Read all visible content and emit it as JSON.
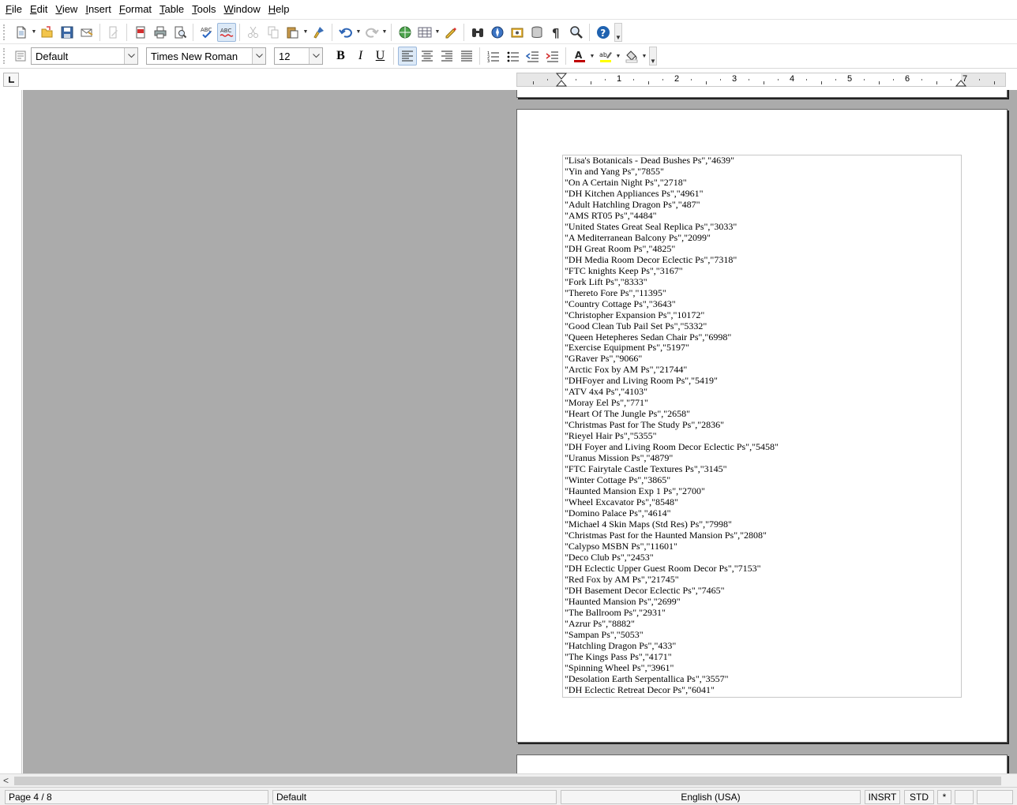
{
  "menu": [
    {
      "label": "File",
      "u": "F",
      "rest": "ile"
    },
    {
      "label": "Edit",
      "u": "E",
      "rest": "dit"
    },
    {
      "label": "View",
      "u": "V",
      "rest": "iew"
    },
    {
      "label": "Insert",
      "u": "I",
      "rest": "nsert"
    },
    {
      "label": "Format",
      "u": "F",
      "rest": "ormat"
    },
    {
      "label": "Table",
      "u": "T",
      "rest": "able"
    },
    {
      "label": "Tools",
      "u": "T",
      "rest": "ools"
    },
    {
      "label": "Window",
      "u": "W",
      "rest": "indow"
    },
    {
      "label": "Help",
      "u": "H",
      "rest": "elp"
    }
  ],
  "formatting": {
    "paragraph_style": "Default",
    "font_name": "Times New Roman",
    "font_size": "12",
    "bold": "B",
    "italic": "I",
    "underline": "U"
  },
  "ruler": {
    "labels": [
      "1",
      "2",
      "3",
      "4",
      "5",
      "6",
      "7"
    ]
  },
  "document": {
    "lines": [
      "\"Lisa's Botanicals - Dead Bushes Ps\",\"4639\"",
      "\"Yin and Yang Ps\",\"7855\"",
      "\"On A Certain Night Ps\",\"2718\"",
      "\"DH Kitchen Appliances Ps\",\"4961\"",
      "\"Adult Hatchling Dragon Ps\",\"487\"",
      "\"AMS RT05 Ps\",\"4484\"",
      "\"United States Great Seal Replica Ps\",\"3033\"",
      "\"A Mediterranean Balcony Ps\",\"2099\"",
      "\"DH Great Room Ps\",\"4825\"",
      "\"DH Media Room Decor Eclectic Ps\",\"7318\"",
      "\"FTC knights Keep Ps\",\"3167\"",
      "\"Fork Lift Ps\",\"8333\"",
      "\"Thereto Fore Ps\",\"11395\"",
      "\"Country Cottage Ps\",\"3643\"",
      "\"Christopher Expansion Ps\",\"10172\"",
      "\"Good Clean Tub Pail Set Ps\",\"5332\"",
      "\"Queen Hetepheres Sedan Chair Ps\",\"6998\"",
      "\"Exercise Equipment Ps\",\"5197\"",
      "\"GRaver Ps\",\"9066\"",
      "\"Arctic Fox by AM Ps\",\"21744\"",
      "\"DHFoyer and Living Room Ps\",\"5419\"",
      "\"ATV 4x4 Ps\",\"4103\"",
      "\"Moray Eel Ps\",\"771\"",
      "\"Heart Of The Jungle Ps\",\"2658\"",
      "\"Christmas Past for The Study Ps\",\"2836\"",
      "\"Rieyel Hair Ps\",\"5355\"",
      "\"DH Foyer and Living Room Decor Eclectic Ps\",\"5458\"",
      "\"Uranus Mission Ps\",\"4879\"",
      "\"FTC Fairytale Castle Textures Ps\",\"3145\"",
      "\"Winter Cottage Ps\",\"3865\"",
      "\"Haunted Mansion Exp 1 Ps\",\"2700\"",
      "\"Wheel Excavator Ps\",\"8548\"",
      "\"Domino Palace Ps\",\"4614\"",
      "\"Michael 4 Skin Maps (Std Res) Ps\",\"7998\"",
      "\"Christmas Past for the Haunted Mansion Ps\",\"2808\"",
      "\"Calypso MSBN Ps\",\"11601\"",
      "\"Deco Club Ps\",\"2453\"",
      "\"DH Eclectic Upper Guest Room Decor Ps\",\"7153\"",
      "\"Red Fox by AM Ps\",\"21745\"",
      "\"DH Basement Decor Eclectic Ps\",\"7465\"",
      "\"Haunted Mansion Ps\",\"2699\"",
      "\"The Ballroom Ps\",\"2931\"",
      "\"Azrur Ps\",\"8882\"",
      "\"Sampan Ps\",\"5053\"",
      "\"Hatchling Dragon Ps\",\"433\"",
      "\"The Kings Pass Ps\",\"4171\"",
      "\"Spinning Wheel Ps\",\"3961\"",
      "\"Desolation Earth Serpentallica Ps\",\"3557\"",
      "\"DH Eclectic Retreat Decor Ps\",\"6041\""
    ]
  },
  "statusbar": {
    "page": "Page 4 / 8",
    "page_style": "Default",
    "language": "English (USA)",
    "insert_mode": "INSRT",
    "selection_mode": "STD",
    "modified": "*"
  },
  "colors": {
    "workspace": "#ababab",
    "font_color_bar": "#c00000",
    "highlight_bar": "#ffff00",
    "help_blue": "#1f62b0"
  }
}
